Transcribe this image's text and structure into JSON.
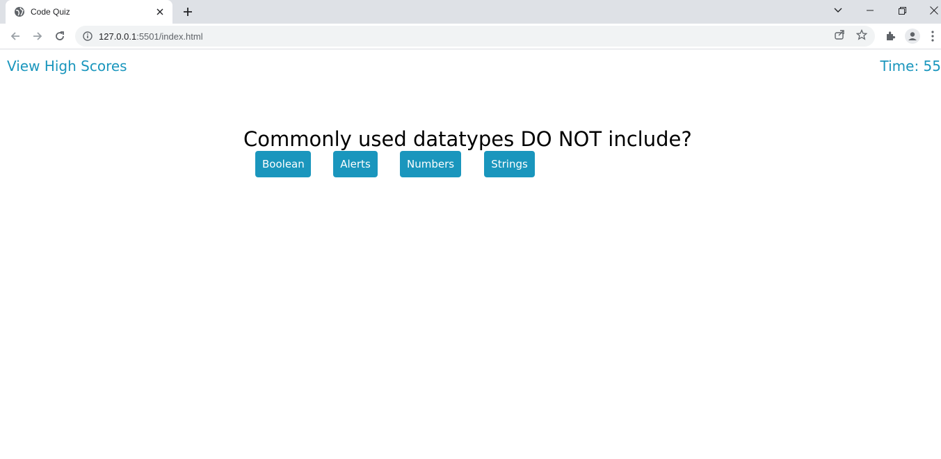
{
  "browser": {
    "tab": {
      "title": "Code Quiz",
      "favicon": "globe-icon",
      "close_icon": "close-icon"
    },
    "new_tab_icon": "plus-icon",
    "window_controls": [
      "chevron-down-icon",
      "minimize-icon",
      "restore-icon",
      "close-icon"
    ],
    "nav": [
      "back-icon",
      "forward-icon",
      "reload-icon"
    ],
    "address": {
      "host": "127.0.0.1",
      "path": ":5501/index.html",
      "site_info_icon": "info-icon"
    },
    "omnibox_actions": [
      "share-icon",
      "star-icon"
    ],
    "toolbar_actions": [
      "extensions-icon",
      "profile-icon",
      "menu-icon"
    ]
  },
  "page": {
    "high_scores_link": "View High Scores",
    "timer": "Time: 55",
    "question": "Commonly used datatypes DO NOT include?",
    "answers": [
      "Boolean",
      "Alerts",
      "Numbers",
      "Strings"
    ]
  },
  "colors": {
    "accent": "#1a96bd",
    "question_text": "#000000"
  }
}
